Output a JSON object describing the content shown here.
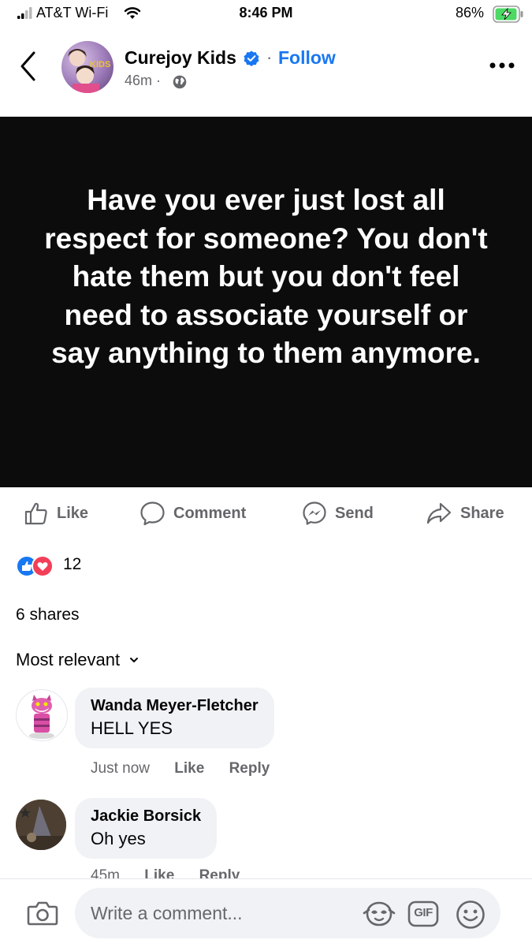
{
  "status_bar": {
    "carrier": "AT&T Wi-Fi",
    "time": "8:46 PM",
    "battery": "86%",
    "icons": [
      "signal-icon",
      "wifi-icon",
      "battery-charging-icon"
    ]
  },
  "header": {
    "page_name": "Curejoy Kids",
    "separator": "·",
    "follow_label": "Follow",
    "time_ago": "46m ·",
    "avatar_text": "KIDS",
    "icons": [
      "back-chevron-icon",
      "verified-badge-icon",
      "globe-icon",
      "more-options-icon"
    ]
  },
  "post": {
    "quote": "Have you ever just lost all respect for someone? You don't hate them but you don't feel need to associate yourself or say anything to them anymore."
  },
  "actions": {
    "like": "Like",
    "comment": "Comment",
    "send": "Send",
    "share": "Share"
  },
  "engagement": {
    "reaction_count": "12",
    "shares": "6 shares",
    "sort_label": "Most relevant"
  },
  "comments": [
    {
      "author": "Wanda Meyer-Fletcher",
      "text": "HELL YES",
      "time": "Just now",
      "like": "Like",
      "reply": "Reply"
    },
    {
      "author": "Jackie Borsick",
      "text": "Oh yes",
      "time": "45m",
      "like": "Like",
      "reply": "Reply"
    }
  ],
  "composer": {
    "placeholder": "Write a comment...",
    "gif_label": "GIF"
  },
  "colors": {
    "accent": "#1877f2",
    "love": "#f33e58",
    "muted_text": "#65676b",
    "bubble": "#f0f2f5",
    "post_background": "#0c0c0c"
  }
}
